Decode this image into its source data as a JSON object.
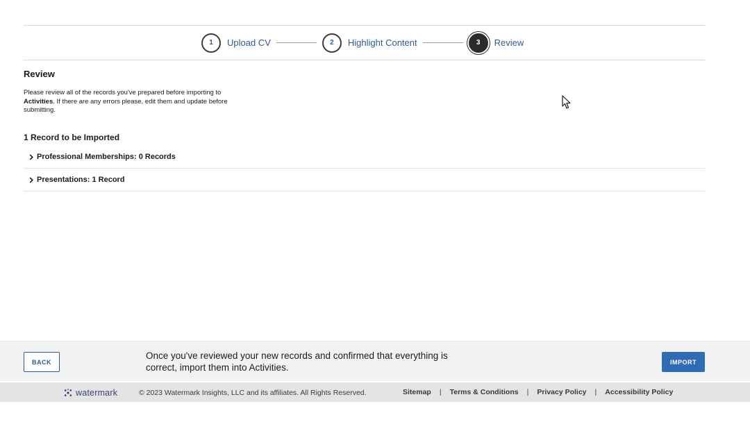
{
  "stepper": {
    "steps": [
      {
        "number": "1",
        "label": "Upload CV"
      },
      {
        "number": "2",
        "label": "Highlight Content"
      },
      {
        "number": "3",
        "label": "Review"
      }
    ]
  },
  "review": {
    "title": "Review",
    "instructions_prefix": "Please review all of the records you've prepared before importing to",
    "instructions_bold": "Activities",
    "instructions_suffix": ". If there are any errors please, edit them and update before submitting.",
    "records_heading": "1 Record to be Imported",
    "sections": [
      {
        "label": "Professional Memberships: 0 Records"
      },
      {
        "label": "Presentations: 1 Record"
      }
    ]
  },
  "action_bar": {
    "back_label": "BACK",
    "message": "Once you've reviewed your new records and confirmed that everything is correct, import them into Activities.",
    "import_label": "IMPORT"
  },
  "footer": {
    "brand_name": "watermark",
    "brand_icon": "watermark-logo-icon",
    "copyright": "© 2023 Watermark Insights, LLC and its affiliates. All Rights Reserved.",
    "links": [
      {
        "label": "Sitemap"
      },
      {
        "label": "Terms & Conditions"
      },
      {
        "label": "Privacy Policy"
      },
      {
        "label": "Accessibility Policy"
      }
    ]
  },
  "colors": {
    "link_blue": "#2d5b8a",
    "primary_button": "#2f6cb5",
    "action_bar_bg": "#f2f2f2",
    "footer_bg": "#e4e4e4"
  }
}
